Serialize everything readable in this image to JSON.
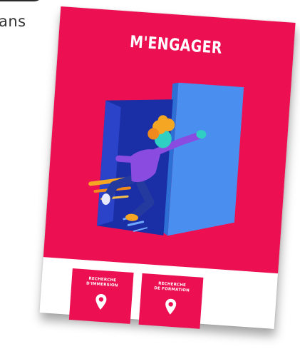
{
  "side_text": "ans",
  "poster": {
    "title": "M'ENGAGER",
    "background": "#ec1053",
    "door_color": "#4a8ff0"
  },
  "tiles": [
    {
      "label": "RECHERCHE\nD'IMMERSION",
      "icon": "location-pin-icon"
    },
    {
      "label": "RECHERCHE\nDE FORMATION",
      "icon": "location-pin-icon"
    }
  ]
}
